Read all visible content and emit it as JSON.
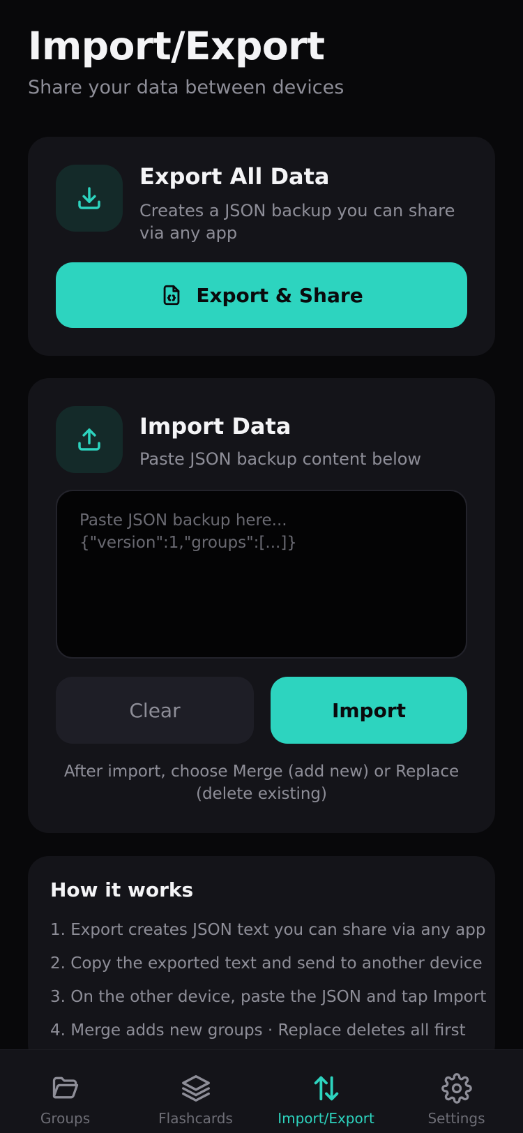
{
  "header": {
    "title": "Import/Export",
    "subtitle": "Share your data between devices"
  },
  "export_card": {
    "icon": "download-icon",
    "title": "Export All Data",
    "description": "Creates a JSON backup you can share via any app",
    "button_icon": "json-file-icon",
    "button_label": "Export & Share"
  },
  "import_card": {
    "icon": "upload-icon",
    "title": "Import Data",
    "description": "Paste JSON backup content below",
    "textarea_value": "",
    "textarea_placeholder": "Paste JSON backup here...\n{\"version\":1,\"groups\":[...]}",
    "clear_label": "Clear",
    "import_label": "Import",
    "note": "After import, choose Merge (add new) or Replace (delete existing)"
  },
  "how_it_works": {
    "title": "How it works",
    "steps": [
      "1. Export creates JSON text you can share via any app",
      "2. Copy the exported text and send to another device",
      "3. On the other device, paste the JSON and tap Import",
      "4. Merge adds new groups · Replace deletes all first"
    ]
  },
  "tab_bar": {
    "tabs": [
      {
        "label": "Groups",
        "icon": "folder-icon",
        "active": false
      },
      {
        "label": "Flashcards",
        "icon": "layers-icon",
        "active": false
      },
      {
        "label": "Import/Export",
        "icon": "arrows-up-down-icon",
        "active": true
      },
      {
        "label": "Settings",
        "icon": "gear-icon",
        "active": false
      }
    ]
  },
  "colors": {
    "accent": "#2dd4bf",
    "background": "#08080a",
    "card": "#141419",
    "muted_text": "#8e8e98"
  }
}
